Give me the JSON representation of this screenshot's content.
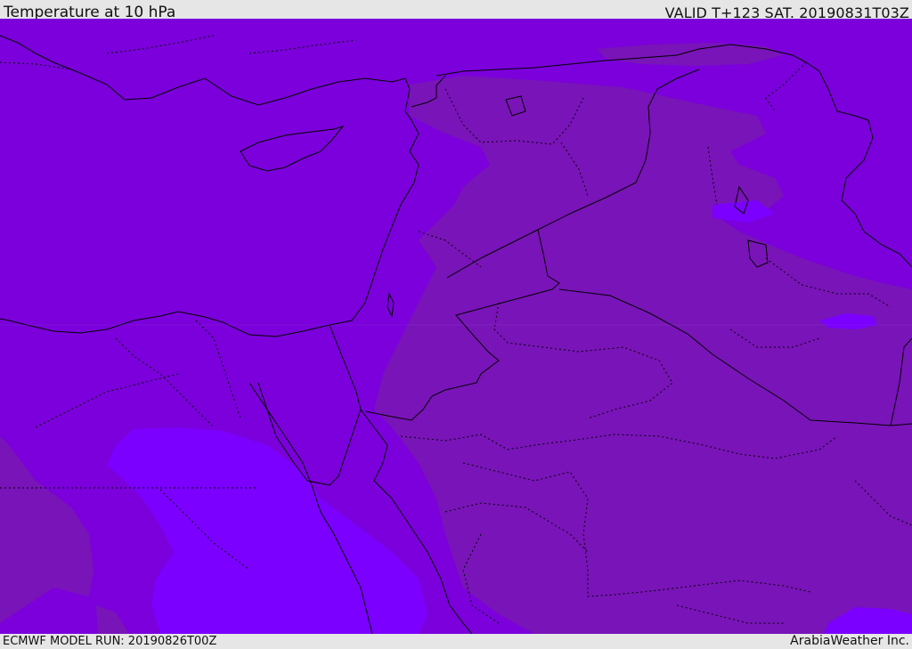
{
  "header": {
    "title": "Temperature at 10 hPa",
    "valid_time": "VALID T+123 SAT. 20190831T03Z"
  },
  "footer": {
    "model_run": "ECMWF MODEL RUN: 20190826T00Z",
    "credit": "ArabiaWeather Inc."
  },
  "map": {
    "colors": {
      "base": "#7b00db",
      "warm_band": "#7914b8",
      "cold_pocket": "#7b00ff",
      "boundary_line": "#000000"
    }
  }
}
